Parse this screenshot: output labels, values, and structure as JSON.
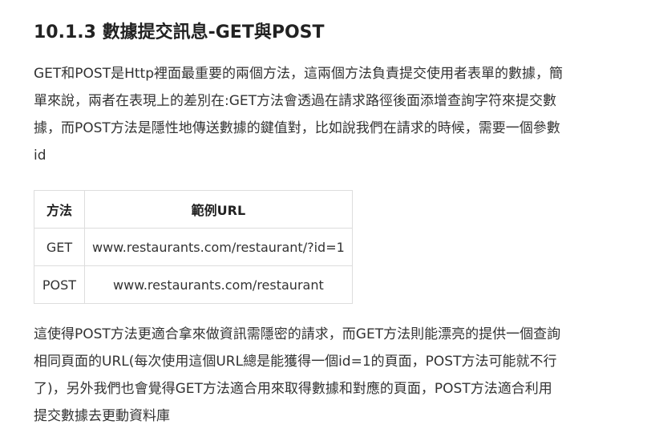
{
  "heading": "10.1.3 數據提交訊息-GET與POST",
  "intro_lines": [
    "GET和POST是Http裡面最重要的兩個方法，這兩個方法負責提交使用者表單的數據，簡",
    "單來說，兩者在表現上的差別在:GET方法會透過在請求路徑後面添增查詢字符來提交數",
    "據，而POST方法是隱性地傳送數據的鍵值對，比如說我們在請求的時候，需要一個參數",
    "id"
  ],
  "table": {
    "headers": [
      "方法",
      "範例URL"
    ],
    "rows": [
      {
        "method": "GET",
        "url": "www.restaurants.com/restaurant/?id=1"
      },
      {
        "method": "POST",
        "url": "www.restaurants.com/restaurant"
      }
    ]
  },
  "closing_lines": [
    "這使得POST方法更適合拿來做資訊需隱密的請求，而GET方法則能漂亮的提供一個查詢",
    "相同頁面的URL(每次使用這個URL總是能獲得一個id=1的頁面，POST方法可能就不行",
    "了)，另外我們也會覺得GET方法適合用來取得數據和對應的頁面，POST方法適合利用",
    "提交數據去更動資料庫"
  ]
}
